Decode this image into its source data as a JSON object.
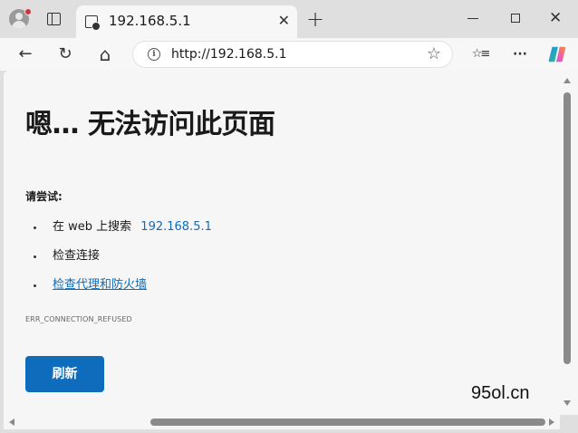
{
  "tab": {
    "title": "192.168.5.1",
    "close_glyph": "✕",
    "favicon": "page-error-icon"
  },
  "window": {
    "new_tab_glyph": "+",
    "close_glyph": "✕"
  },
  "toolbar": {
    "back_glyph": "←",
    "refresh_glyph": "↻",
    "home_glyph": "⌂",
    "address_url": "http://192.168.5.1",
    "info_glyph": "i",
    "favorite_glyph": "☆",
    "favorites_glyph": "☆≡",
    "more_glyph": "···"
  },
  "error_page": {
    "heading": "嗯… 无法访问此页面",
    "try_label": "请尝试:",
    "suggestions": [
      {
        "text": "在 web 上搜索",
        "link": "192.168.5.1"
      },
      {
        "text": "检查连接"
      },
      {
        "link": "检查代理和防火墙"
      }
    ],
    "error_code": "ERR_CONNECTION_REFUSED",
    "refresh_label": "刷新"
  },
  "watermark": "95ol.cn",
  "colors": {
    "accent": "#0f6cbd",
    "page_bg": "#f6f6f6",
    "chrome_bg": "#dfdfdf"
  }
}
